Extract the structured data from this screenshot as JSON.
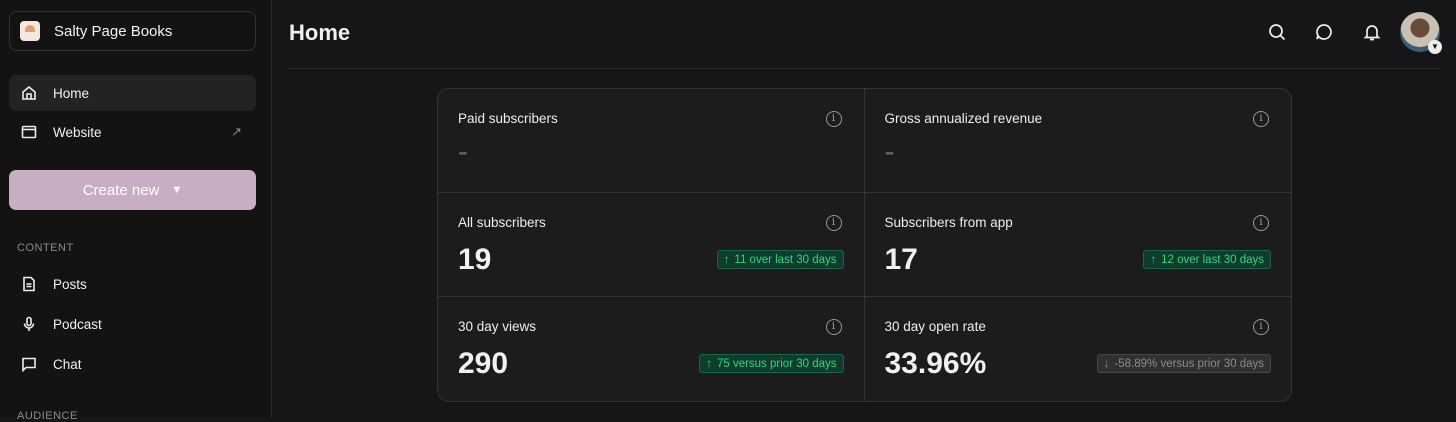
{
  "sidebar": {
    "publication": "Salty Page Books",
    "nav": [
      {
        "label": "Home",
        "icon": "home-icon"
      },
      {
        "label": "Website",
        "icon": "browser-icon"
      }
    ],
    "create_label": "Create new",
    "content_heading": "CONTENT",
    "content_items": [
      {
        "label": "Posts"
      },
      {
        "label": "Podcast"
      },
      {
        "label": "Chat"
      }
    ],
    "next_heading": "AUDIENCE"
  },
  "header": {
    "title": "Home"
  },
  "stats": [
    {
      "label": "Paid subscribers",
      "value": "-"
    },
    {
      "label": "Gross annualized revenue",
      "value": "-"
    },
    {
      "label": "All subscribers",
      "value": "19",
      "badge": "11 over last 30 days",
      "trend": "up"
    },
    {
      "label": "Subscribers from app",
      "value": "17",
      "badge": "12 over last 30 days",
      "trend": "up"
    },
    {
      "label": "30 day views",
      "value": "290",
      "badge": "75 versus prior 30 days",
      "trend": "up"
    },
    {
      "label": "30 day open rate",
      "value": "33.96%",
      "badge": "-58.89% versus prior 30 days",
      "trend": "down"
    }
  ],
  "colors": {
    "accent": "#c7aec4",
    "up": "#2fd68a"
  }
}
